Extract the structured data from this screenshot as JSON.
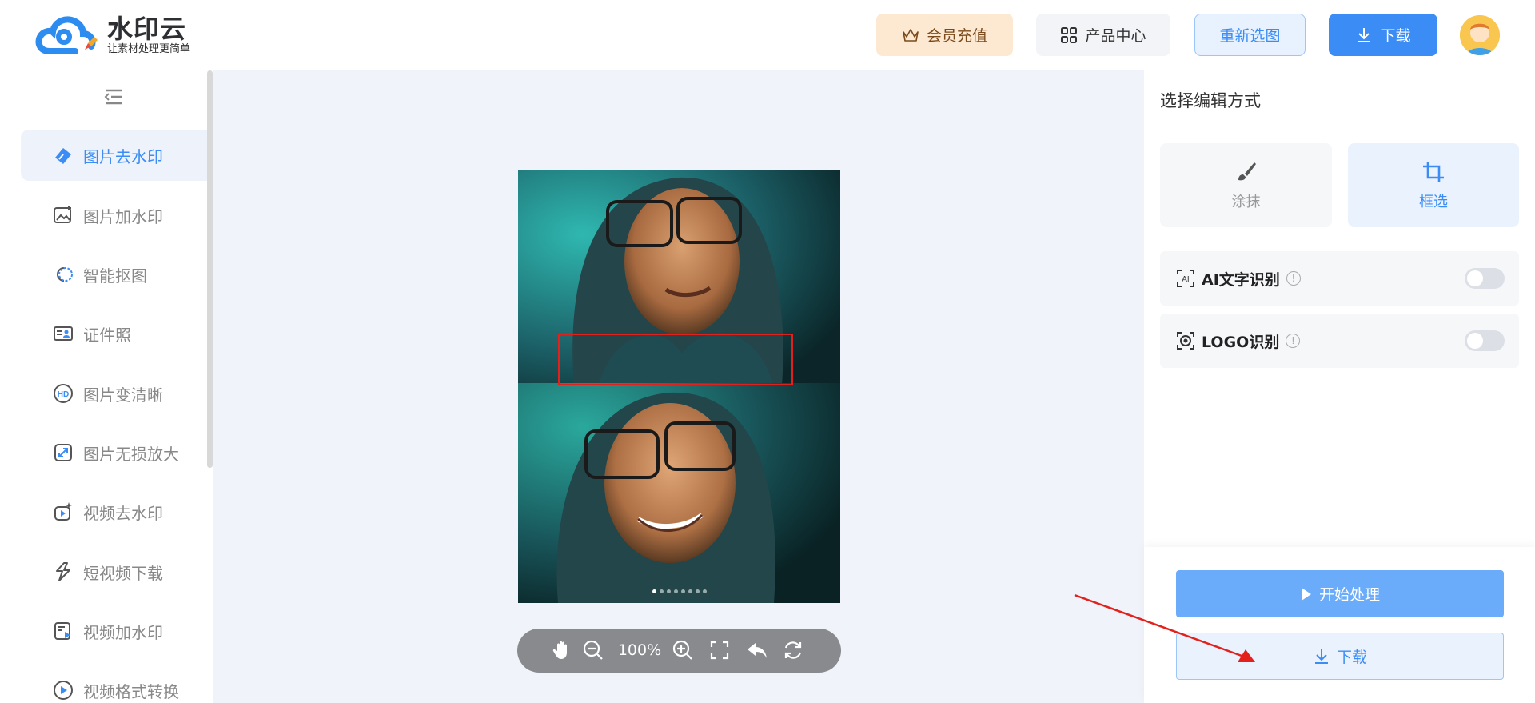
{
  "header": {
    "logo_title": "水印云",
    "logo_subtitle": "让素材处理更简单",
    "vip_label": "会员充值",
    "products_label": "产品中心",
    "reselect_label": "重新选图",
    "download_label": "下载"
  },
  "sidebar": {
    "items": [
      {
        "label": "图片去水印",
        "icon": "eraser-icon",
        "active": true
      },
      {
        "label": "图片加水印",
        "icon": "image-add-icon"
      },
      {
        "label": "智能抠图",
        "icon": "cutout-icon"
      },
      {
        "label": "证件照",
        "icon": "id-card-icon"
      },
      {
        "label": "图片变清晰",
        "icon": "hd-icon"
      },
      {
        "label": "图片无损放大",
        "icon": "enlarge-icon"
      },
      {
        "label": "视频去水印",
        "icon": "video-magic-icon"
      },
      {
        "label": "短视频下载",
        "icon": "short-video-icon"
      },
      {
        "label": "视频加水印",
        "icon": "video-add-icon"
      },
      {
        "label": "视频格式转换",
        "icon": "video-convert-icon"
      }
    ]
  },
  "canvas": {
    "zoom": "100%",
    "page_dots": 8,
    "active_dot": 0
  },
  "right_panel": {
    "title": "选择编辑方式",
    "modes": [
      {
        "label": "涂抹",
        "icon": "brush-icon",
        "selected": false
      },
      {
        "label": "框选",
        "icon": "crop-icon",
        "selected": true
      }
    ],
    "options": [
      {
        "label": "AI文字识别",
        "icon": "ai-text-icon",
        "enabled": false
      },
      {
        "label": "LOGO识别",
        "icon": "logo-detect-icon",
        "enabled": false
      }
    ],
    "start_label": "开始处理",
    "download_label": "下载"
  },
  "colors": {
    "accent": "#3b8cf5",
    "selection": "#e3201b",
    "vip_bg": "#fde8d2"
  }
}
